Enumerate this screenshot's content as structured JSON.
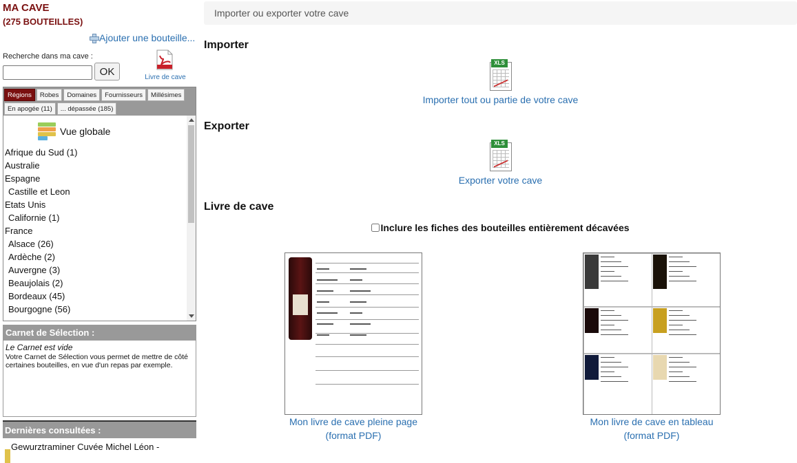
{
  "sidebar": {
    "title": "MA CAVE",
    "count": "(275 BOUTEILLES)",
    "add_bottle": "Ajouter une bouteille...",
    "search_label": "Recherche dans ma cave :",
    "search_value": "",
    "ok_label": "OK",
    "livre_label": "Livre de cave",
    "tabs_row1": [
      "Régions",
      "Robes",
      "Domaines",
      "Fournisseurs",
      "Millésimes"
    ],
    "tabs_row2": [
      "En apogée (11)",
      "... dépassée (185)"
    ],
    "active_tab": "Régions",
    "vue_globale": "Vue globale",
    "regions": [
      {
        "label": "Afrique du Sud (1)",
        "sub": false
      },
      {
        "label": "Australie",
        "sub": false
      },
      {
        "label": "Espagne",
        "sub": false
      },
      {
        "label": "Castille et Leon",
        "sub": true
      },
      {
        "label": "Etats Unis",
        "sub": false
      },
      {
        "label": "Californie (1)",
        "sub": true
      },
      {
        "label": "France",
        "sub": false
      },
      {
        "label": "Alsace (26)",
        "sub": true
      },
      {
        "label": "Ardèche (2)",
        "sub": true
      },
      {
        "label": "Auvergne (3)",
        "sub": true
      },
      {
        "label": "Beaujolais (2)",
        "sub": true
      },
      {
        "label": "Bordeaux (45)",
        "sub": true
      },
      {
        "label": "Bourgogne (56)",
        "sub": true
      }
    ],
    "carnet": {
      "header": "Carnet de Sélection :",
      "empty": "Le Carnet est vide",
      "desc": "Votre Carnet de Sélection vous permet de mettre de côté certaines bouteilles, en vue d'un repas par exemple."
    },
    "dernieres": {
      "header": "Dernières consultées :",
      "item": "Gewurztraminer Cuvée Michel Léon -"
    }
  },
  "main": {
    "header": "Importer ou exporter votre cave",
    "import_title": "Importer",
    "import_link": "Importer tout ou partie de votre cave",
    "export_title": "Exporter",
    "export_link": "Exporter votre cave",
    "livre_title": "Livre de cave",
    "include_label": "Inclure les fiches des bouteilles entièrement décavées",
    "include_checked": false,
    "xls_tag": "XLS",
    "thumb1_caption": [
      "Mon livre de cave pleine page",
      "(format PDF)"
    ],
    "thumb2_caption": [
      "Mon livre de cave en tableau",
      "(format PDF)"
    ]
  },
  "colors": {
    "brand": "#7a1010",
    "link": "#2a6fb0",
    "panel": "#999999"
  }
}
